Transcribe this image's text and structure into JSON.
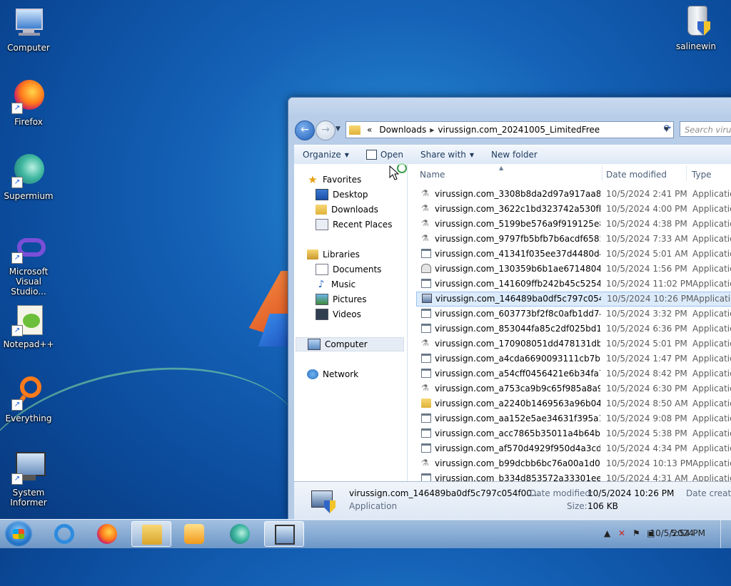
{
  "desktop": {
    "icons": [
      {
        "label": "Computer"
      },
      {
        "label": "Firefox"
      },
      {
        "label": "Supermium"
      },
      {
        "label": "Microsoft Visual Studio..."
      },
      {
        "label": "Notepad++"
      },
      {
        "label": "Everything"
      },
      {
        "label": "System Informer"
      },
      {
        "label": "salinewin"
      }
    ]
  },
  "explorer": {
    "breadcrumb": {
      "overflow": "«",
      "items": [
        "Downloads",
        "virussign.com_20241005_LimitedFree"
      ]
    },
    "search_placeholder": "Search virussign...",
    "toolbar": {
      "organize": "Organize",
      "open": "Open",
      "share_with": "Share with",
      "new_folder": "New folder"
    },
    "nav": {
      "favorites": "Favorites",
      "desktop": "Desktop",
      "downloads": "Downloads",
      "recent_places": "Recent Places",
      "libraries": "Libraries",
      "documents": "Documents",
      "music": "Music",
      "pictures": "Pictures",
      "videos": "Videos",
      "computer": "Computer",
      "network": "Network"
    },
    "columns": {
      "name": "Name",
      "date_modified": "Date modified",
      "type": "Type"
    },
    "files": [
      {
        "name": "virussign.com_3308b8da2d97a917aa8c45...",
        "date": "10/5/2024 2:41 PM",
        "type": "Application",
        "icon": "gear"
      },
      {
        "name": "virussign.com_3622c1bd323742a530fb1c...",
        "date": "10/5/2024 4:00 PM",
        "type": "Application",
        "icon": "gear"
      },
      {
        "name": "virussign.com_5199be576a9f919125e8d4...",
        "date": "10/5/2024 4:38 PM",
        "type": "Application",
        "icon": "gear"
      },
      {
        "name": "virussign.com_9797fb5bfb7b6acdf65855a...",
        "date": "10/5/2024 7:33 AM",
        "type": "Application",
        "icon": "gear"
      },
      {
        "name": "virussign.com_41341f035ee37d4480d4600...",
        "date": "10/5/2024 5:01 AM",
        "type": "Application",
        "icon": "app"
      },
      {
        "name": "virussign.com_130359b6b1ae6714804620...",
        "date": "10/5/2024 1:56 PM",
        "type": "Application",
        "icon": "drive"
      },
      {
        "name": "virussign.com_141609ffb242b45c5254f40...",
        "date": "10/5/2024 11:02 PM",
        "type": "Application",
        "icon": "app"
      },
      {
        "name": "virussign.com_146489ba0df5c797c054f00...",
        "date": "10/5/2024 10:26 PM",
        "type": "Application",
        "icon": "monitor",
        "selected": true
      },
      {
        "name": "virussign.com_603773bf2f8c0afb1dd745b...",
        "date": "10/5/2024 3:32 PM",
        "type": "Application",
        "icon": "app"
      },
      {
        "name": "virussign.com_853044fa85c2df025bd1603...",
        "date": "10/5/2024 6:36 PM",
        "type": "Application",
        "icon": "app"
      },
      {
        "name": "virussign.com_170908051dd478131db495...",
        "date": "10/5/2024 5:01 PM",
        "type": "Application",
        "icon": "gear"
      },
      {
        "name": "virussign.com_a4cda6690093111cb7bb20...",
        "date": "10/5/2024 1:47 PM",
        "type": "Application",
        "icon": "app"
      },
      {
        "name": "virussign.com_a54cff0456421e6b34fa775...",
        "date": "10/5/2024 8:42 PM",
        "type": "Application",
        "icon": "app"
      },
      {
        "name": "virussign.com_a753ca9b9c65f985a8a9095...",
        "date": "10/5/2024 6:30 PM",
        "type": "Application",
        "icon": "gear"
      },
      {
        "name": "virussign.com_a2240b1469563a96b0435d...",
        "date": "10/5/2024 8:50 AM",
        "type": "Application",
        "icon": "folder"
      },
      {
        "name": "virussign.com_aa152e5ae34631f395a165f...",
        "date": "10/5/2024 9:08 PM",
        "type": "Application",
        "icon": "app"
      },
      {
        "name": "virussign.com_acc7865b35011a4b64b60b...",
        "date": "10/5/2024 5:38 PM",
        "type": "Application",
        "icon": "app"
      },
      {
        "name": "virussign.com_af570d4929f950d4a3cd526...",
        "date": "10/5/2024 4:34 PM",
        "type": "Application",
        "icon": "app"
      },
      {
        "name": "virussign.com_b99dcbb6bc76a00a1d0694...",
        "date": "10/5/2024 10:13 PM",
        "type": "Application",
        "icon": "gear"
      },
      {
        "name": "virussign.com_b334d853572a33301ee916...",
        "date": "10/5/2024 4:31 AM",
        "type": "Application",
        "icon": "app"
      }
    ],
    "details": {
      "name": "virussign.com_146489ba0df5c797c054f00...",
      "type": "Application",
      "date_modified_label": "Date modified:",
      "date_modified": "10/5/2024 10:26 PM",
      "size_label": "Size:",
      "size": "106 KB",
      "date_created_label": "Date created:"
    }
  },
  "taskbar": {
    "clock_time": "5:54 PM",
    "clock_date": "10/5/2024"
  }
}
